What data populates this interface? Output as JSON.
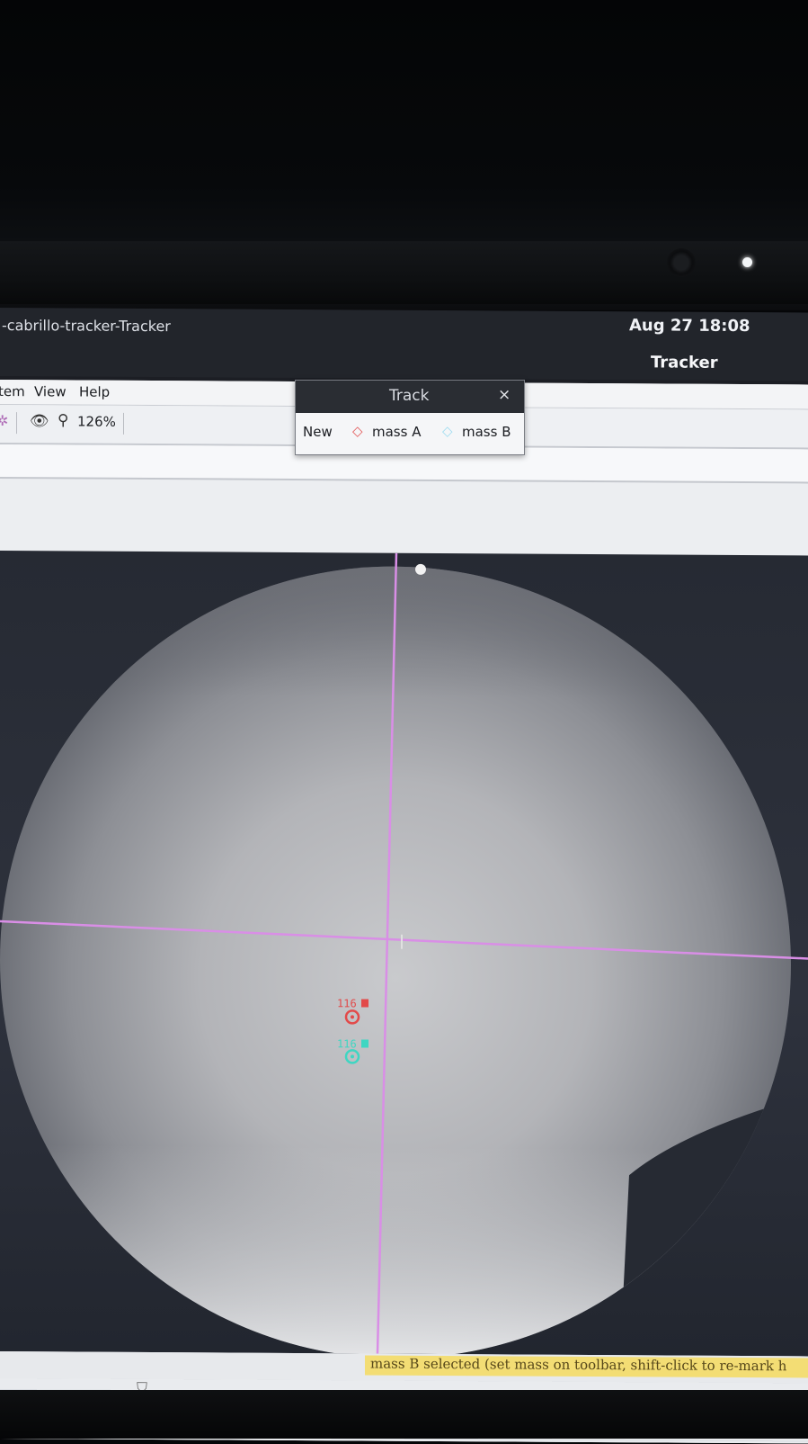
{
  "desktop": {
    "window_title": "-cabrillo-tracker-Tracker",
    "clock": "Aug 27  18:08",
    "app_name": "Tracker"
  },
  "menu": {
    "items": [
      "tem",
      "View",
      "Help"
    ]
  },
  "toolbar": {
    "star_icon": "sparkle-icon",
    "eye_icon": "eye-icon",
    "zoom_icon": "magnifier-icon",
    "zoom": "126%"
  },
  "track_dialog": {
    "title": "Track",
    "close": "×",
    "new_label": "New",
    "mass_a_icon": "◇",
    "mass_a": "mass A",
    "mass_b_icon": "◇",
    "mass_b": "mass B"
  },
  "video": {
    "axes_color": "#d98ee6",
    "mass_a_label": "116",
    "mass_a_color": "#e24a4a",
    "mass_b_label": "116",
    "mass_b_color": "#3fd6c2"
  },
  "status": {
    "message": "mass B selected (set mass on toolbar, shift-click to re-mark h"
  }
}
